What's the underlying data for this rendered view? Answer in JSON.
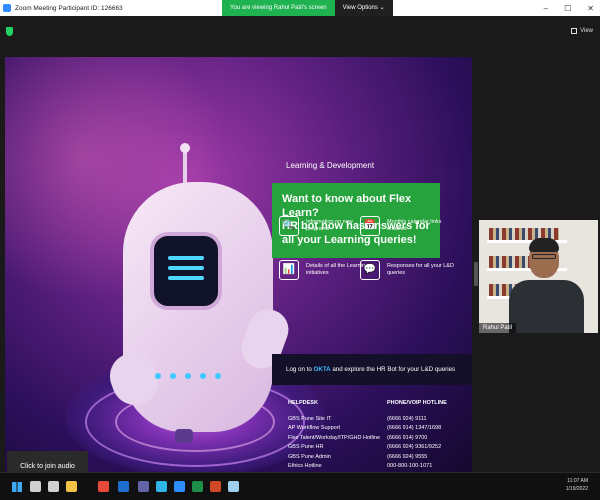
{
  "window": {
    "title": "Zoom Meeting Participant ID: 126663",
    "controls": [
      "–",
      "☐",
      "✕"
    ]
  },
  "share_banner": {
    "viewing": "You are viewing Rahul Patil's screen",
    "view_options": "View Options ⌄"
  },
  "meeting_bar": {
    "view_label": "View"
  },
  "slide": {
    "section_title": "Learning & Development",
    "headline_lines": [
      "Want to know about Flex Learn?",
      "HR bot now has answers for",
      "all your Learning queries!"
    ],
    "features": [
      {
        "icon": "document-search-icon",
        "glyph": "🔍",
        "text": "Information on new programs"
      },
      {
        "icon": "calendar-icon",
        "glyph": "📅",
        "text": "Monthly calendar links enabled"
      },
      {
        "icon": "presentation-icon",
        "glyph": "📊",
        "text": "Details of all the Learning initiatives"
      },
      {
        "icon": "chat-response-icon",
        "glyph": "💬",
        "text": "Responses for all your L&D queries"
      }
    ],
    "okta_prefix": "Log on to ",
    "okta_link": "OKTA",
    "okta_suffix": " and explore the HR Bot for your L&D queries",
    "helpdesk": {
      "col1_header": "HELPDESK",
      "col2_header": "PHONE/VOIP HOTLINE",
      "rows": [
        [
          "GBS Pune Site IT",
          "(6666 924) 9111"
        ],
        [
          "AP Workflow Support",
          "(6666 914) 1347/1698"
        ],
        [
          "Flex Talent/Workday/ITP/GHD Hotline",
          "(6666 914) 9700"
        ],
        [
          "GBS Pune HR",
          "(6666 924) 9361/9252"
        ],
        [
          "GBS Pune Admin",
          "(6666 924) 9555"
        ],
        [
          "Ethics Hotline",
          "000-800-100-1071"
        ]
      ]
    }
  },
  "participant": {
    "name": "Rahul Patil"
  },
  "audio": {
    "join_label": "Click to join audio"
  },
  "taskbar": {
    "time": "11:07 AM",
    "date": "1/19/2022",
    "icons": [
      {
        "name": "search-icon",
        "color": "#d0d0d0"
      },
      {
        "name": "task-view-icon",
        "color": "#d0d0d0"
      },
      {
        "name": "file-explorer-icon",
        "color": "#f3c443"
      },
      {
        "name": "chrome-icon",
        "color": "#e84a3a"
      },
      {
        "name": "outlook-icon",
        "color": "#1f6fd1"
      },
      {
        "name": "teams-icon",
        "color": "#6264a7"
      },
      {
        "name": "edge-icon",
        "color": "#2fb5e8"
      },
      {
        "name": "zoom-icon",
        "color": "#2d8cff"
      },
      {
        "name": "excel-icon",
        "color": "#1d8f48"
      },
      {
        "name": "powerpoint-icon",
        "color": "#d24726"
      },
      {
        "name": "notepad-icon",
        "color": "#9fd0ef"
      }
    ]
  },
  "colors": {
    "share_green": "#1fb250",
    "headline_green": "#26a33c",
    "okta_blue": "#3fb8ff"
  }
}
